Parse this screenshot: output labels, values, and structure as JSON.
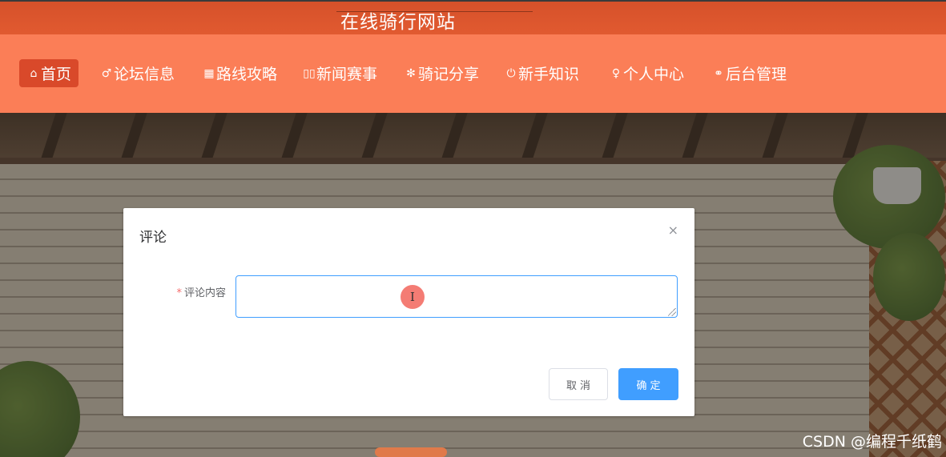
{
  "header": {
    "site_title": "在线骑行网站"
  },
  "nav": {
    "items": [
      {
        "icon": "home-icon",
        "glyph": "⌂",
        "label": "首页",
        "active": true
      },
      {
        "icon": "forum-icon",
        "glyph": "♂",
        "label": "论坛信息",
        "active": false
      },
      {
        "icon": "route-icon",
        "glyph": "▦",
        "label": "路线攻略",
        "active": false
      },
      {
        "icon": "news-icon",
        "glyph": "▯▯",
        "label": "新闻赛事",
        "active": false
      },
      {
        "icon": "share-icon",
        "glyph": "✻",
        "label": "骑记分享",
        "active": false
      },
      {
        "icon": "knowledge-icon",
        "glyph": "⏻",
        "label": "新手知识",
        "active": false
      },
      {
        "icon": "user-icon",
        "glyph": "♀",
        "label": "个人中心",
        "active": false
      },
      {
        "icon": "link-icon",
        "glyph": "⚭",
        "label": "后台管理",
        "active": false
      }
    ]
  },
  "dialog": {
    "title": "评论",
    "close_glyph": "×",
    "field": {
      "required_mark": "*",
      "label": "评论内容",
      "value": ""
    },
    "cursor_glyph": "I",
    "cancel_label": "取消",
    "confirm_label": "确定"
  },
  "watermark": "CSDN @编程千纸鹤",
  "colors": {
    "header": "#e15a30",
    "nav": "#fb7e57",
    "nav_active": "#d9492a",
    "primary": "#409eff",
    "required": "#f56c6c"
  }
}
